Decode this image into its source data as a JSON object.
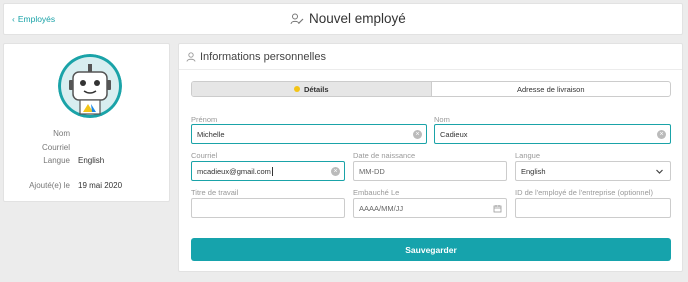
{
  "header": {
    "back_label": "Employés",
    "title": "Nouvel employé"
  },
  "profile": {
    "rows": [
      {
        "label": "Nom",
        "value": ""
      },
      {
        "label": "Courriel",
        "value": ""
      },
      {
        "label": "Langue",
        "value": "English"
      },
      {
        "label": "Ajouté(e) le",
        "value": "19 mai 2020"
      }
    ]
  },
  "section": {
    "title": "Informations personnelles"
  },
  "tabs": [
    {
      "label": "Détails",
      "active": true
    },
    {
      "label": "Adresse de livraison",
      "active": false
    }
  ],
  "form": {
    "first_name": {
      "label": "Prénom",
      "value": "Michelle"
    },
    "last_name": {
      "label": "Nom",
      "value": "Cadieux"
    },
    "email": {
      "label": "Courriel",
      "value": "mcadieux@gmail.com"
    },
    "birth_date": {
      "label": "Date de naissance",
      "placeholder": "MM-DD"
    },
    "language": {
      "label": "Langue",
      "value": "English"
    },
    "job_title": {
      "label": "Titre de travail",
      "value": ""
    },
    "hire_date": {
      "label": "Embauché Le",
      "placeholder": "AAAA/MM/JJ"
    },
    "employee_id": {
      "label": "ID de l'employé de l'entreprise (optionnel)",
      "value": ""
    }
  },
  "save_label": "Sauvegarder",
  "colors": {
    "accent": "#16a3ac",
    "active_dot": "#f3c417"
  }
}
